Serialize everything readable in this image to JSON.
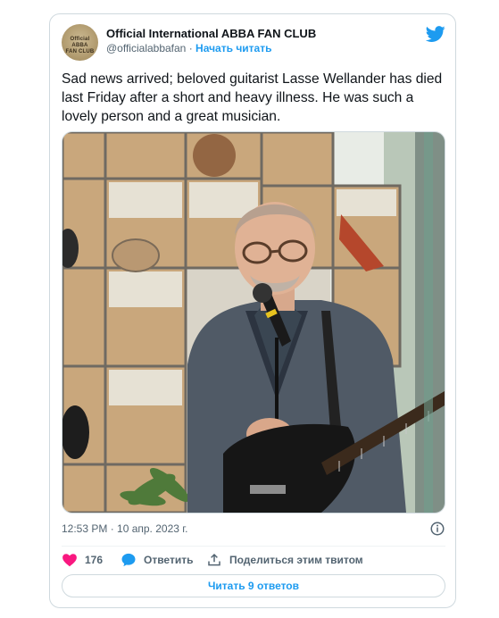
{
  "author": {
    "display_name": "Official International ABBA FAN CLUB",
    "handle": "@officialabbafan",
    "separator": "·",
    "follow_label": "Начать читать",
    "avatar_text": "Official International ABBA FAN CLUB"
  },
  "tweet": {
    "text": "Sad news arrived; beloved guitarist Lasse Wellander has died last Friday after a short and heavy illness. He was such a lovely person and a great musician.",
    "timestamp": "12:53 PM · 10 апр. 2023 г."
  },
  "actions": {
    "like_count": "176",
    "reply_label": "Ответить",
    "share_label": "Поделиться этим твитом"
  },
  "read_replies_label": "Читать 9 ответов",
  "icons": {
    "brand": "twitter-bird-icon",
    "info": "info-icon",
    "like": "heart-icon",
    "reply": "speech-bubble-icon",
    "share": "share-upload-icon"
  },
  "colors": {
    "accent": "#1d9bf0",
    "like": "#f91880",
    "muted": "#536471",
    "border": "#cfd9de"
  }
}
